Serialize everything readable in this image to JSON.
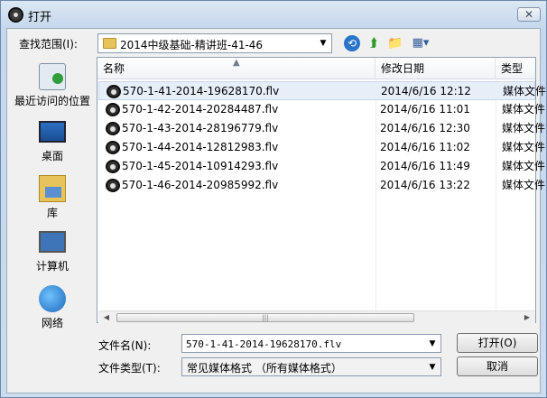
{
  "window": {
    "title": "打开",
    "close_glyph": "✕"
  },
  "lookin": {
    "label": "查找范围(I):",
    "value": "2014中级基础-精讲班-41-46"
  },
  "toolbar": {
    "back": "⟲",
    "up": "⮭",
    "new_folder": "📁",
    "view": "▦▾"
  },
  "places": [
    {
      "label": "最近访问的位置",
      "icon": "recent-places-icon"
    },
    {
      "label": "桌面",
      "icon": "desktop-icon"
    },
    {
      "label": "库",
      "icon": "libraries-icon"
    },
    {
      "label": "计算机",
      "icon": "computer-icon"
    },
    {
      "label": "网络",
      "icon": "network-icon"
    }
  ],
  "columns": {
    "name": "名称",
    "date": "修改日期",
    "type": "类型"
  },
  "files": [
    {
      "name": "570-1-41-2014-19628170.flv",
      "date": "2014/6/16 12:12",
      "type": "媒体文件"
    },
    {
      "name": "570-1-42-2014-20284487.flv",
      "date": "2014/6/16 11:01",
      "type": "媒体文件"
    },
    {
      "name": "570-1-43-2014-28196779.flv",
      "date": "2014/6/16 12:30",
      "type": "媒体文件"
    },
    {
      "name": "570-1-44-2014-12812983.flv",
      "date": "2014/6/16 11:02",
      "type": "媒体文件"
    },
    {
      "name": "570-1-45-2014-10914293.flv",
      "date": "2014/6/16 11:49",
      "type": "媒体文件"
    },
    {
      "name": "570-1-46-2014-20985992.flv",
      "date": "2014/6/16 13:22",
      "type": "媒体文件"
    }
  ],
  "filename": {
    "label": "文件名(N):",
    "value": "570-1-41-2014-19628170.flv"
  },
  "filetype": {
    "label": "文件类型(T):",
    "value": "常见媒体格式 （所有媒体格式）"
  },
  "buttons": {
    "open": "打开(O)",
    "cancel": "取消"
  }
}
